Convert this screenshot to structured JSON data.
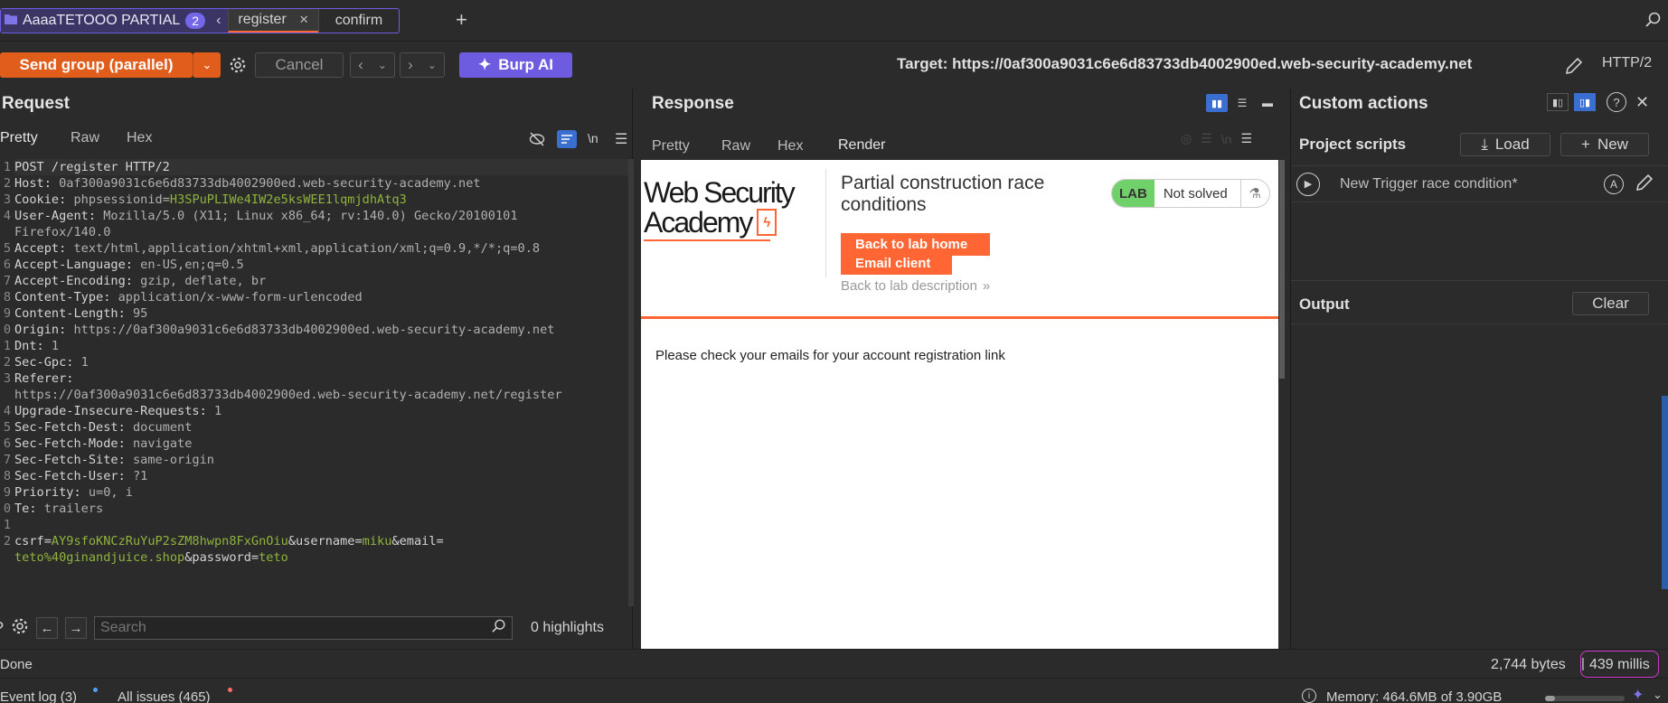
{
  "tabs": {
    "group_name": "AaaaTETOOO PARTIAL",
    "group_count": "2",
    "tab_register": "register",
    "tab_confirm": "confirm",
    "add_symbol": "+"
  },
  "toolbar": {
    "send_label": "Send group (parallel)",
    "cancel_label": "Cancel",
    "burp_ai_label": "Burp AI",
    "target_label": "Target: https://0af300a9031c6e6d83733db4002900ed.web-security-academy.net",
    "protocol": "HTTP/2"
  },
  "request": {
    "title": "Request",
    "tabs": [
      "Pretty",
      "Raw",
      "Hex"
    ],
    "newline_toggle": "\\n",
    "lines": [
      {
        "n": "1",
        "k": "POST /register HTTP/2",
        "v": ""
      },
      {
        "n": "2",
        "k": "Host: ",
        "v": "0af300a9031c6e6d83733db4002900ed.web-security-academy.net"
      },
      {
        "n": "3",
        "k": "Cookie: ",
        "v": "phpsessionid="
      },
      {
        "n": "4",
        "k": "User-Agent: ",
        "v": "Mozilla/5.0 (X11; Linux x86_64; rv:140.0) Gecko/20100101"
      },
      {
        "n": "",
        "k": "",
        "v": "Firefox/140.0"
      },
      {
        "n": "5",
        "k": "Accept: ",
        "v": "text/html,application/xhtml+xml,application/xml;q=0.9,*/*;q=0.8"
      },
      {
        "n": "6",
        "k": "Accept-Language: ",
        "v": "en-US,en;q=0.5"
      },
      {
        "n": "7",
        "k": "Accept-Encoding: ",
        "v": "gzip, deflate, br"
      },
      {
        "n": "8",
        "k": "Content-Type: ",
        "v": "application/x-www-form-urlencoded"
      },
      {
        "n": "9",
        "k": "Content-Length: ",
        "v": "95"
      },
      {
        "n": "0",
        "k": "Origin: ",
        "v": "https://0af300a9031c6e6d83733db4002900ed.web-security-academy.net"
      },
      {
        "n": "1",
        "k": "Dnt: ",
        "v": "1"
      },
      {
        "n": "2",
        "k": "Sec-Gpc: ",
        "v": "1"
      },
      {
        "n": "3",
        "k": "Referer: ",
        "v": ""
      },
      {
        "n": "",
        "k": "",
        "v": "https://0af300a9031c6e6d83733db4002900ed.web-security-academy.net/register"
      },
      {
        "n": "4",
        "k": "Upgrade-Insecure-Requests: ",
        "v": "1"
      },
      {
        "n": "5",
        "k": "Sec-Fetch-Dest: ",
        "v": "document"
      },
      {
        "n": "6",
        "k": "Sec-Fetch-Mode: ",
        "v": "navigate"
      },
      {
        "n": "7",
        "k": "Sec-Fetch-Site: ",
        "v": "same-origin"
      },
      {
        "n": "8",
        "k": "Sec-Fetch-User: ",
        "v": "?1"
      },
      {
        "n": "9",
        "k": "Priority: ",
        "v": "u=0, i"
      },
      {
        "n": "0",
        "k": "Te: ",
        "v": "trailers"
      },
      {
        "n": "1",
        "k": "",
        "v": ""
      },
      {
        "n": "2",
        "k": "",
        "v": ""
      },
      {
        "n": "",
        "k": "",
        "v": ""
      }
    ],
    "cookie_value": "H3SPuPLIWe4IW2e5ksWEE1lqmjdhAtq3",
    "body": {
      "csrf_key": "csrf=",
      "csrf_val": "AY9sfoKNCzRuYuP2sZM8hwpn8FxGnOiu",
      "user_key": "&username=",
      "user_val": "miku",
      "email_key": "&email=",
      "email_val": "teto%40ginandjuice.shop",
      "pass_key": "&password=",
      "pass_val": "teto"
    },
    "search_placeholder": "Search",
    "highlights": "0 highlights"
  },
  "response": {
    "title": "Response",
    "tabs": [
      "Pretty",
      "Raw",
      "Hex",
      "Render"
    ],
    "logo_line1": "Web Security",
    "logo_line2": "Academy",
    "lab_title": "Partial construction race conditions",
    "lab_badge": "LAB",
    "lab_status": "Not solved",
    "back_home": "Back to lab home",
    "email_client": "Email client",
    "back_desc": "Back to lab description",
    "message": "Please check your emails for your account registration link"
  },
  "custom_actions": {
    "title": "Custom actions",
    "project_scripts": "Project scripts",
    "load_label": "Load",
    "new_label": "New",
    "script_name": "New Trigger race condition*",
    "output_label": "Output",
    "clear_label": "Clear"
  },
  "status": {
    "left": "Done",
    "bytes": "2,744 bytes",
    "millis": "439 millis"
  },
  "bottom": {
    "event_log": "Event log (3)",
    "all_issues": "All issues (465)",
    "memory": "Memory: 464.6MB of 3.90GB"
  },
  "colors": {
    "accent": "#e05d1c",
    "burp_ai": "#6e5ce0",
    "group_border": "#6b5fe6",
    "lab_green": "#70d16a",
    "wsa_orange": "#ff6633"
  }
}
